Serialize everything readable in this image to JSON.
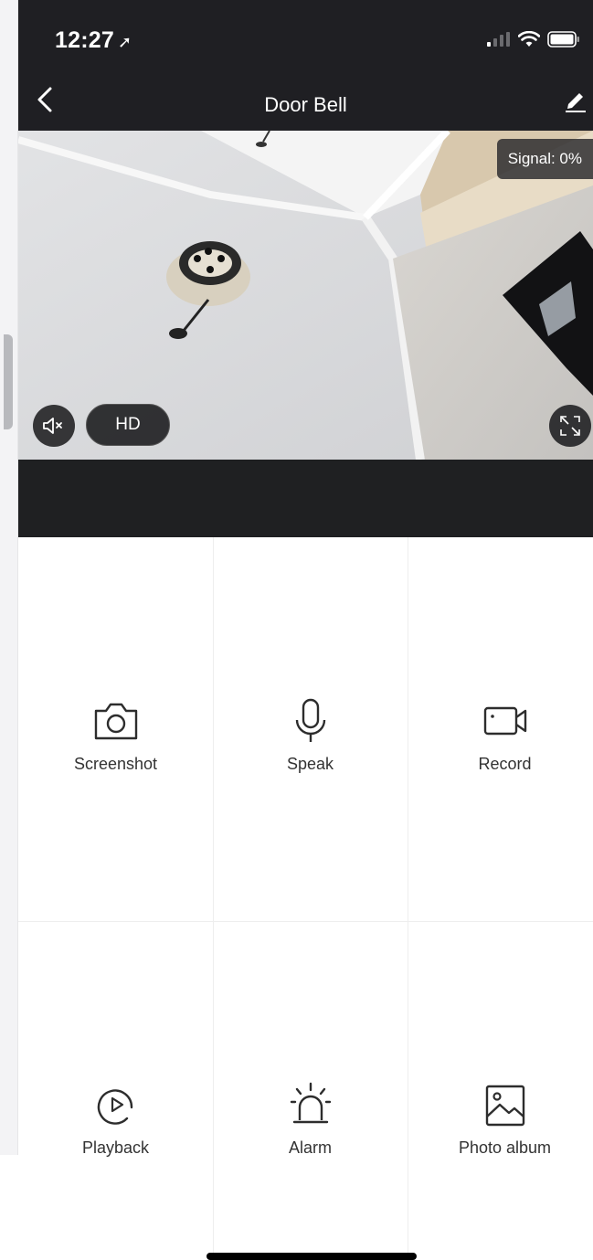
{
  "status_bar": {
    "time": "12:27",
    "location_glyph": "➚",
    "icons": [
      "cellular-signal-icon",
      "wifi-icon",
      "battery-icon"
    ]
  },
  "header": {
    "title": "Door Bell",
    "back_icon": "chevron-left-icon",
    "edit_icon": "pencil-icon"
  },
  "video": {
    "signal_text": "Signal: 0%",
    "quality_label": "HD",
    "mute_icon": "speaker-muted-icon",
    "fullscreen_icon": "fullscreen-icon"
  },
  "actions": [
    {
      "label": "Screenshot",
      "icon": "camera-icon"
    },
    {
      "label": "Speak",
      "icon": "microphone-icon"
    },
    {
      "label": "Record",
      "icon": "video-camera-icon"
    },
    {
      "label": "Playback",
      "icon": "playback-icon"
    },
    {
      "label": "Alarm",
      "icon": "alarm-siren-icon"
    },
    {
      "label": "Photo album",
      "icon": "photo-album-icon"
    }
  ],
  "colors": {
    "header_bg": "#1f1f23",
    "icon_stroke": "#2d2d2d",
    "label": "#333333"
  }
}
